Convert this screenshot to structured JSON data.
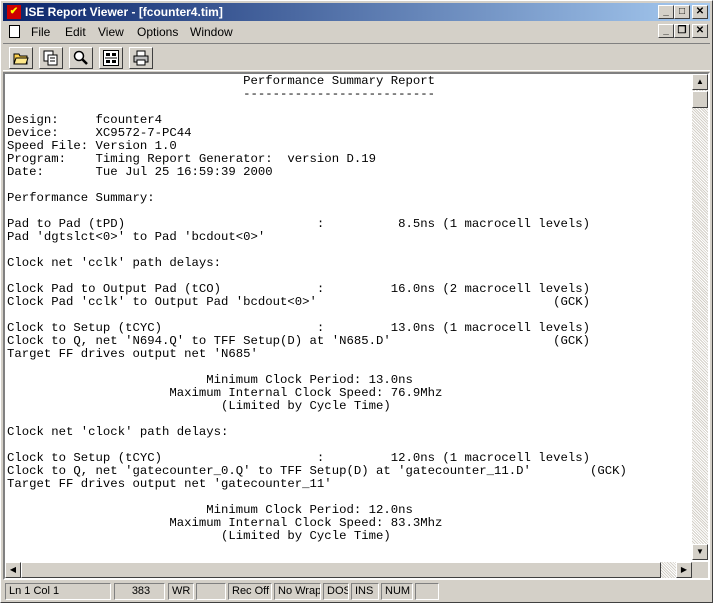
{
  "window": {
    "title": "ISE Report Viewer - [fcounter4.tim]",
    "app_icon_glyph": "ISE"
  },
  "title_buttons": {
    "minimize": "_",
    "maximize": "□",
    "close": "✕"
  },
  "menu": [
    {
      "label": "File"
    },
    {
      "label": "Edit"
    },
    {
      "label": "View"
    },
    {
      "label": "Options"
    },
    {
      "label": "Window"
    }
  ],
  "child_buttons": {
    "minimize": "_",
    "restore": "❐",
    "close": "✕"
  },
  "toolbar": [
    {
      "name": "open-file-button",
      "icon": "folder-open-icon"
    },
    {
      "name": "copy-button",
      "icon": "copy-icon"
    },
    {
      "name": "find-button",
      "icon": "magnifier-icon"
    },
    {
      "name": "font-button",
      "icon": "font-icon"
    },
    {
      "name": "print-button",
      "icon": "printer-icon"
    }
  ],
  "report": {
    "lines": [
      "                                Performance Summary Report",
      "                                --------------------------",
      "",
      "Design:     fcounter4",
      "Device:     XC9572-7-PC44",
      "Speed File: Version 1.0",
      "Program:    Timing Report Generator:  version D.19",
      "Date:       Tue Jul 25 16:59:39 2000",
      "",
      "Performance Summary:",
      "",
      "Pad to Pad (tPD)                          :          8.5ns (1 macrocell levels)",
      "Pad 'dgtslct<0>' to Pad 'bcdout<0>'",
      "",
      "Clock net 'cclk' path delays:",
      "",
      "Clock Pad to Output Pad (tCO)             :         16.0ns (2 macrocell levels)",
      "Clock Pad 'cclk' to Output Pad 'bcdout<0>'                                (GCK)",
      "",
      "Clock to Setup (tCYC)                     :         13.0ns (1 macrocell levels)",
      "Clock to Q, net 'N694.Q' to TFF Setup(D) at 'N685.D'                      (GCK)",
      "Target FF drives output net 'N685'",
      "",
      "                           Minimum Clock Period: 13.0ns",
      "                      Maximum Internal Clock Speed: 76.9Mhz",
      "                             (Limited by Cycle Time)",
      "",
      "Clock net 'clock' path delays:",
      "",
      "Clock to Setup (tCYC)                     :         12.0ns (1 macrocell levels)",
      "Clock to Q, net 'gatecounter_0.Q' to TFF Setup(D) at 'gatecounter_11.D'        (GCK)",
      "Target FF drives output net 'gatecounter_11'",
      "",
      "                           Minimum Clock Period: 12.0ns",
      "                      Maximum Internal Clock Speed: 83.3Mhz",
      "                             (Limited by Cycle Time)",
      "",
      "--------------------------------------------------------------------------------"
    ]
  },
  "status": {
    "position": "Ln 1 Col 1",
    "count": "383",
    "wr": "WR",
    "rec": "Rec Off",
    "wrap": "No Wrap",
    "format": "DOS",
    "ins": "INS",
    "num": "NUM"
  }
}
